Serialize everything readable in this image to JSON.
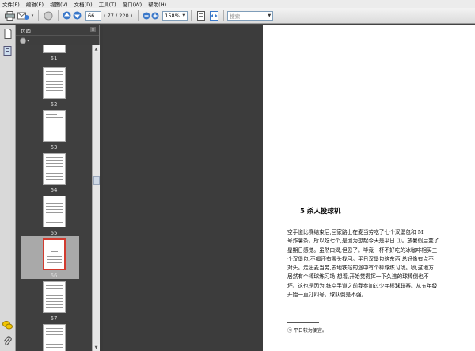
{
  "menubar": {
    "items": [
      "文件(F)",
      "编辑(E)",
      "视图(V)",
      "文档(D)",
      "工具(T)",
      "窗口(W)",
      "帮助(H)"
    ]
  },
  "toolbar": {
    "current_page": "66",
    "page_count": "( 77 / 220 )",
    "zoom": "158%",
    "search_placeholder": "搜索"
  },
  "panel": {
    "title": "页面",
    "close_label": "×"
  },
  "thumbnails": [
    {
      "label": "61",
      "selected": false
    },
    {
      "label": "62",
      "selected": false
    },
    {
      "label": "63",
      "selected": false
    },
    {
      "label": "64",
      "selected": false
    },
    {
      "label": "65",
      "selected": false
    },
    {
      "label": "66",
      "selected": true
    },
    {
      "label": "67",
      "selected": false
    }
  ],
  "document": {
    "chapter_title": "5   杀人投球机",
    "paragraph_lines": [
      "      空手道比赛结束后,回家路上在麦当劳吃了七个汉堡包和 M",
      "号炸薯条。所以吃七个,是因为想起今天是平日 ①。放暑假后变了",
      "星期日感觉。虽然口渴,但忍了。毕竟一杯不好吃的冰咖啡相买三",
      "个汉堡包,不喝还有零头找回。平日汉堡包这东西,总好像有点不",
      "对头。走出麦当劳,去地铁站的途中有个棒球练习场。喷,这地方",
      "居然有个棒球练习场!想着,开始觉得挥一下久违的球棒倒也不",
      "坏。这也是因为,练空手道之前我参加过少年棒球联赛。从五年级",
      "开始一直打四号。球队倒是不强。"
    ],
    "footnote": "①   平日较为便宜。"
  },
  "colors": {
    "selection_border": "#d23b2f",
    "viewer_bg": "#3c3c3c",
    "thumb_panel_bg": "#3f3f3f"
  }
}
